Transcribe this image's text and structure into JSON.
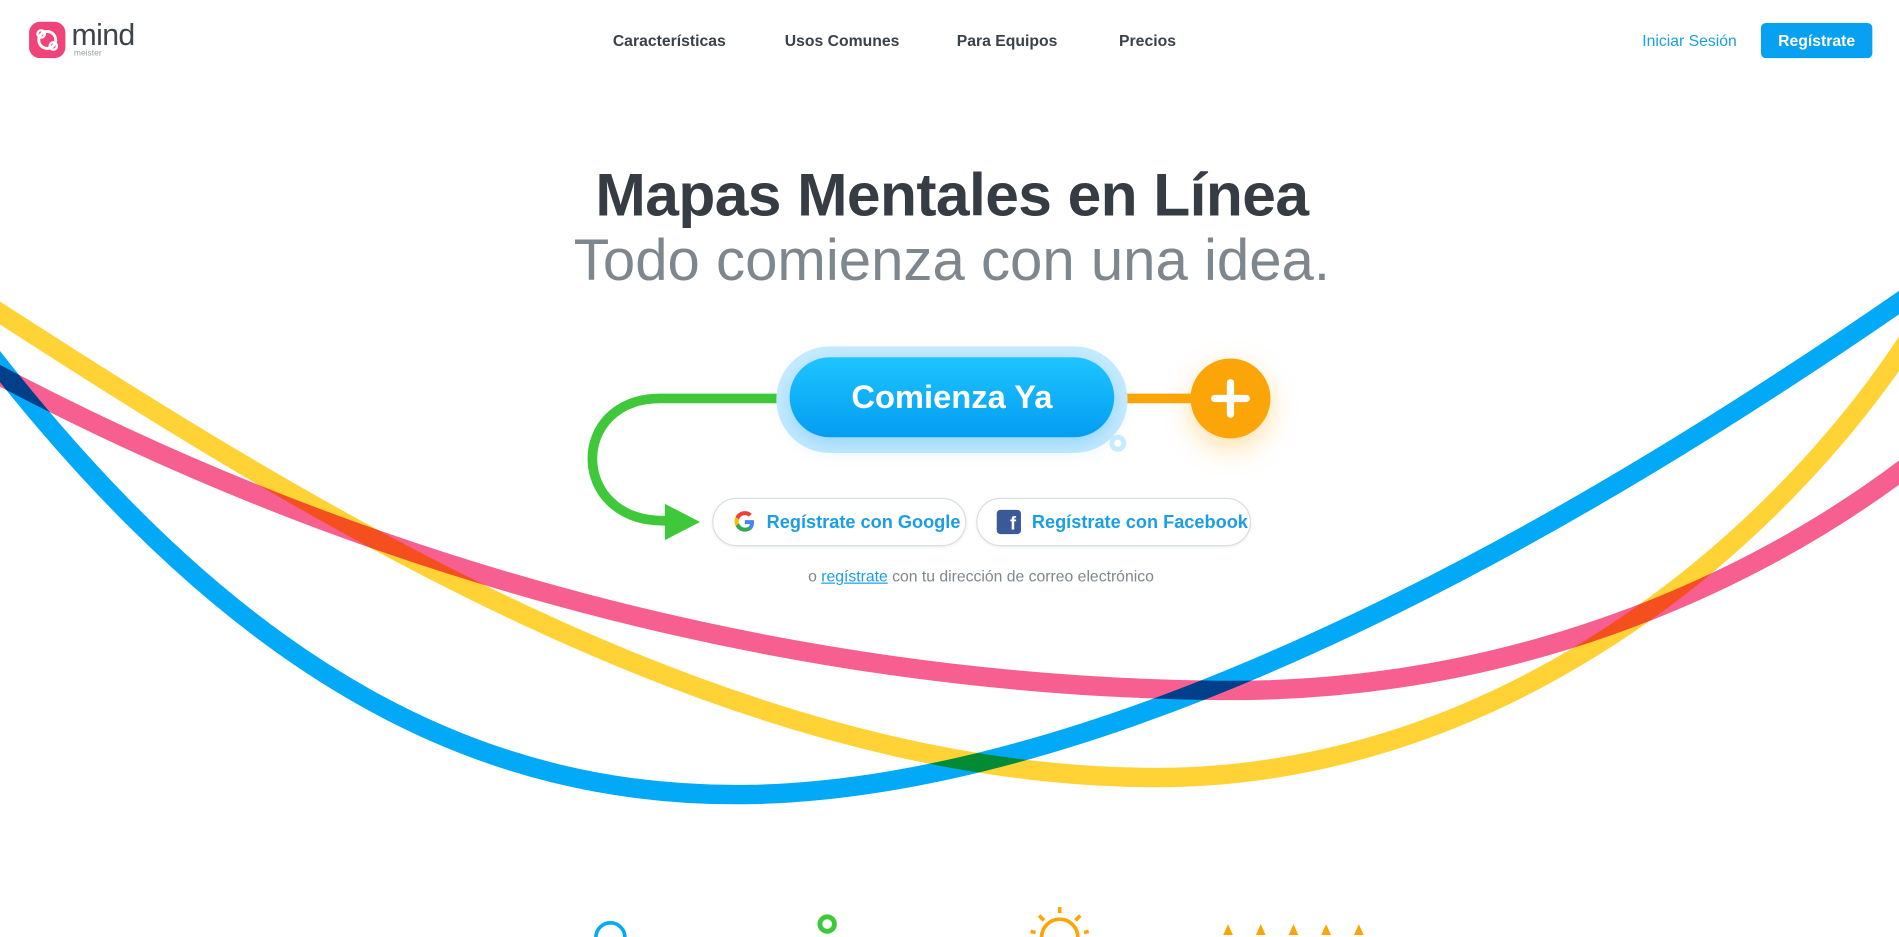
{
  "header": {
    "logo": {
      "word": "mind",
      "sub": "meister"
    },
    "nav": [
      {
        "label": "Características"
      },
      {
        "label": "Usos Comunes"
      },
      {
        "label": "Para Equipos"
      },
      {
        "label": "Precios"
      }
    ],
    "login_label": "Iniciar Sesión",
    "signup_label": "Regístrate"
  },
  "hero": {
    "title": "Mapas Mentales en Línea",
    "subtitle": "Todo comienza con una idea.",
    "cta_label": "Comienza Ya",
    "google_label": "Regístrate con Google",
    "facebook_label": "Regístrate con Facebook",
    "email_prefix": "o ",
    "email_link": "regístrate",
    "email_suffix": " con tu dirección de correo electrónico"
  },
  "colors": {
    "brand_pink": "#f0437a",
    "accent_blue": "#08a0f0",
    "cta_orange": "#fba508",
    "line_green": "#3ec83a",
    "line_yellow": "#ffd02a",
    "line_pink": "#f6568a",
    "line_blue": "#02a9f7"
  },
  "icons": [
    "logo-mark-icon",
    "plus-icon",
    "google-icon",
    "facebook-icon",
    "arrow-icon",
    "feature-icons"
  ]
}
